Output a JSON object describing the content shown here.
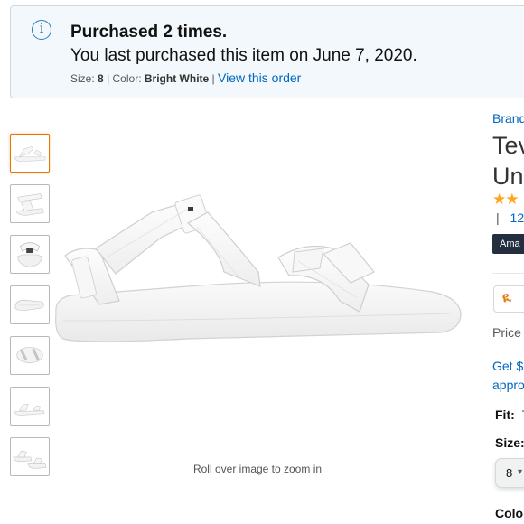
{
  "alert": {
    "icon": "info-icon",
    "title": "Purchased 2 times.",
    "body": "You last purchased this item on June 7, 2020.",
    "size_label": "Size:",
    "size_value": "8",
    "color_label": "Color:",
    "color_value": "Bright White",
    "view_link": "View this order"
  },
  "gallery": {
    "thumbnail_count": 7,
    "selected_index": 0,
    "zoom_hint": "Roll over image to zoom in"
  },
  "product": {
    "brand_link": "Brand",
    "title_line1": "Tev",
    "title_line2": "Un",
    "stars": "★★",
    "ratings_sep": "|",
    "ratings_count": "12",
    "badge": "Ama",
    "prime_glyph": "ዪ",
    "price_label": "Price",
    "promo_line1": "Get $",
    "promo_line2": "appro",
    "fit_label": "Fit:",
    "fit_value": "T",
    "size_label": "Size:",
    "size_selected": "8",
    "color_label": "Colo"
  },
  "colors": {
    "accent_orange": "#e77600",
    "link_blue": "#0066c0",
    "alert_bg": "#f2f8fb",
    "star": "#ffa41c",
    "badge_bg": "#232f3e"
  }
}
